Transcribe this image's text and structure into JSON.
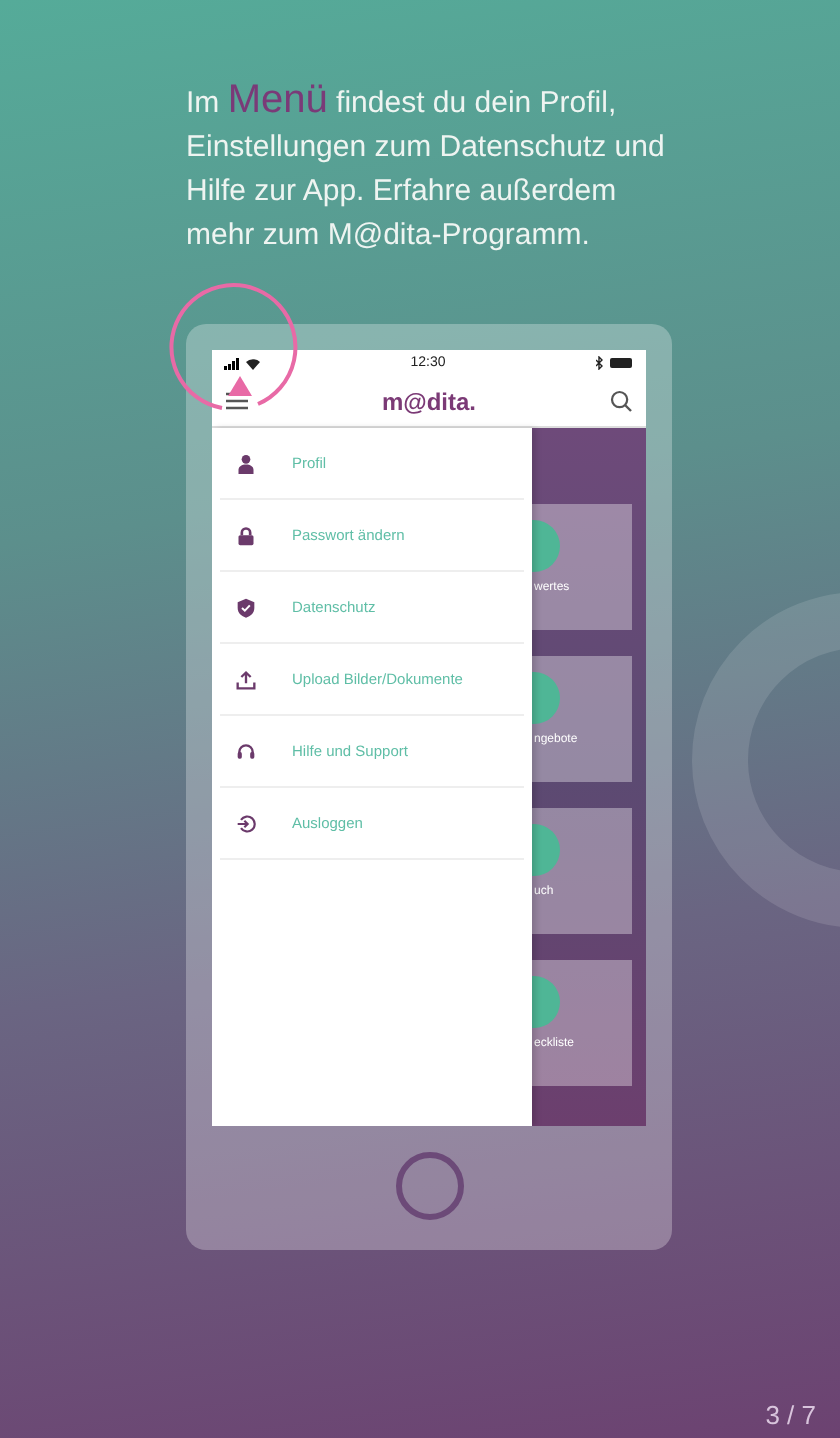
{
  "intro": {
    "text_before": "Im ",
    "highlight": "Menü",
    "text_after": " findest du dein Profil, Einstellungen zum Datenschutz und Hilfe zur App. Erfahre außerdem mehr zum M@dita-Programm."
  },
  "phone": {
    "status_time": "12:30",
    "logo": "m@dita.",
    "menu": [
      {
        "label": "Profil",
        "kind": "person"
      },
      {
        "label": "Passwort ändern",
        "kind": "lock"
      },
      {
        "label": "Datenschutz",
        "kind": "shield"
      },
      {
        "label": "Upload Bilder/Dokumente",
        "kind": "upload"
      },
      {
        "label": "Hilfe und Support",
        "kind": "headset"
      },
      {
        "label": "Ausloggen",
        "kind": "logout"
      }
    ],
    "tiles": [
      {
        "label": "wertes"
      },
      {
        "label": "ngebote"
      },
      {
        "label": "uch"
      },
      {
        "label": "eckliste"
      }
    ]
  },
  "page_counter": "3 / 7"
}
